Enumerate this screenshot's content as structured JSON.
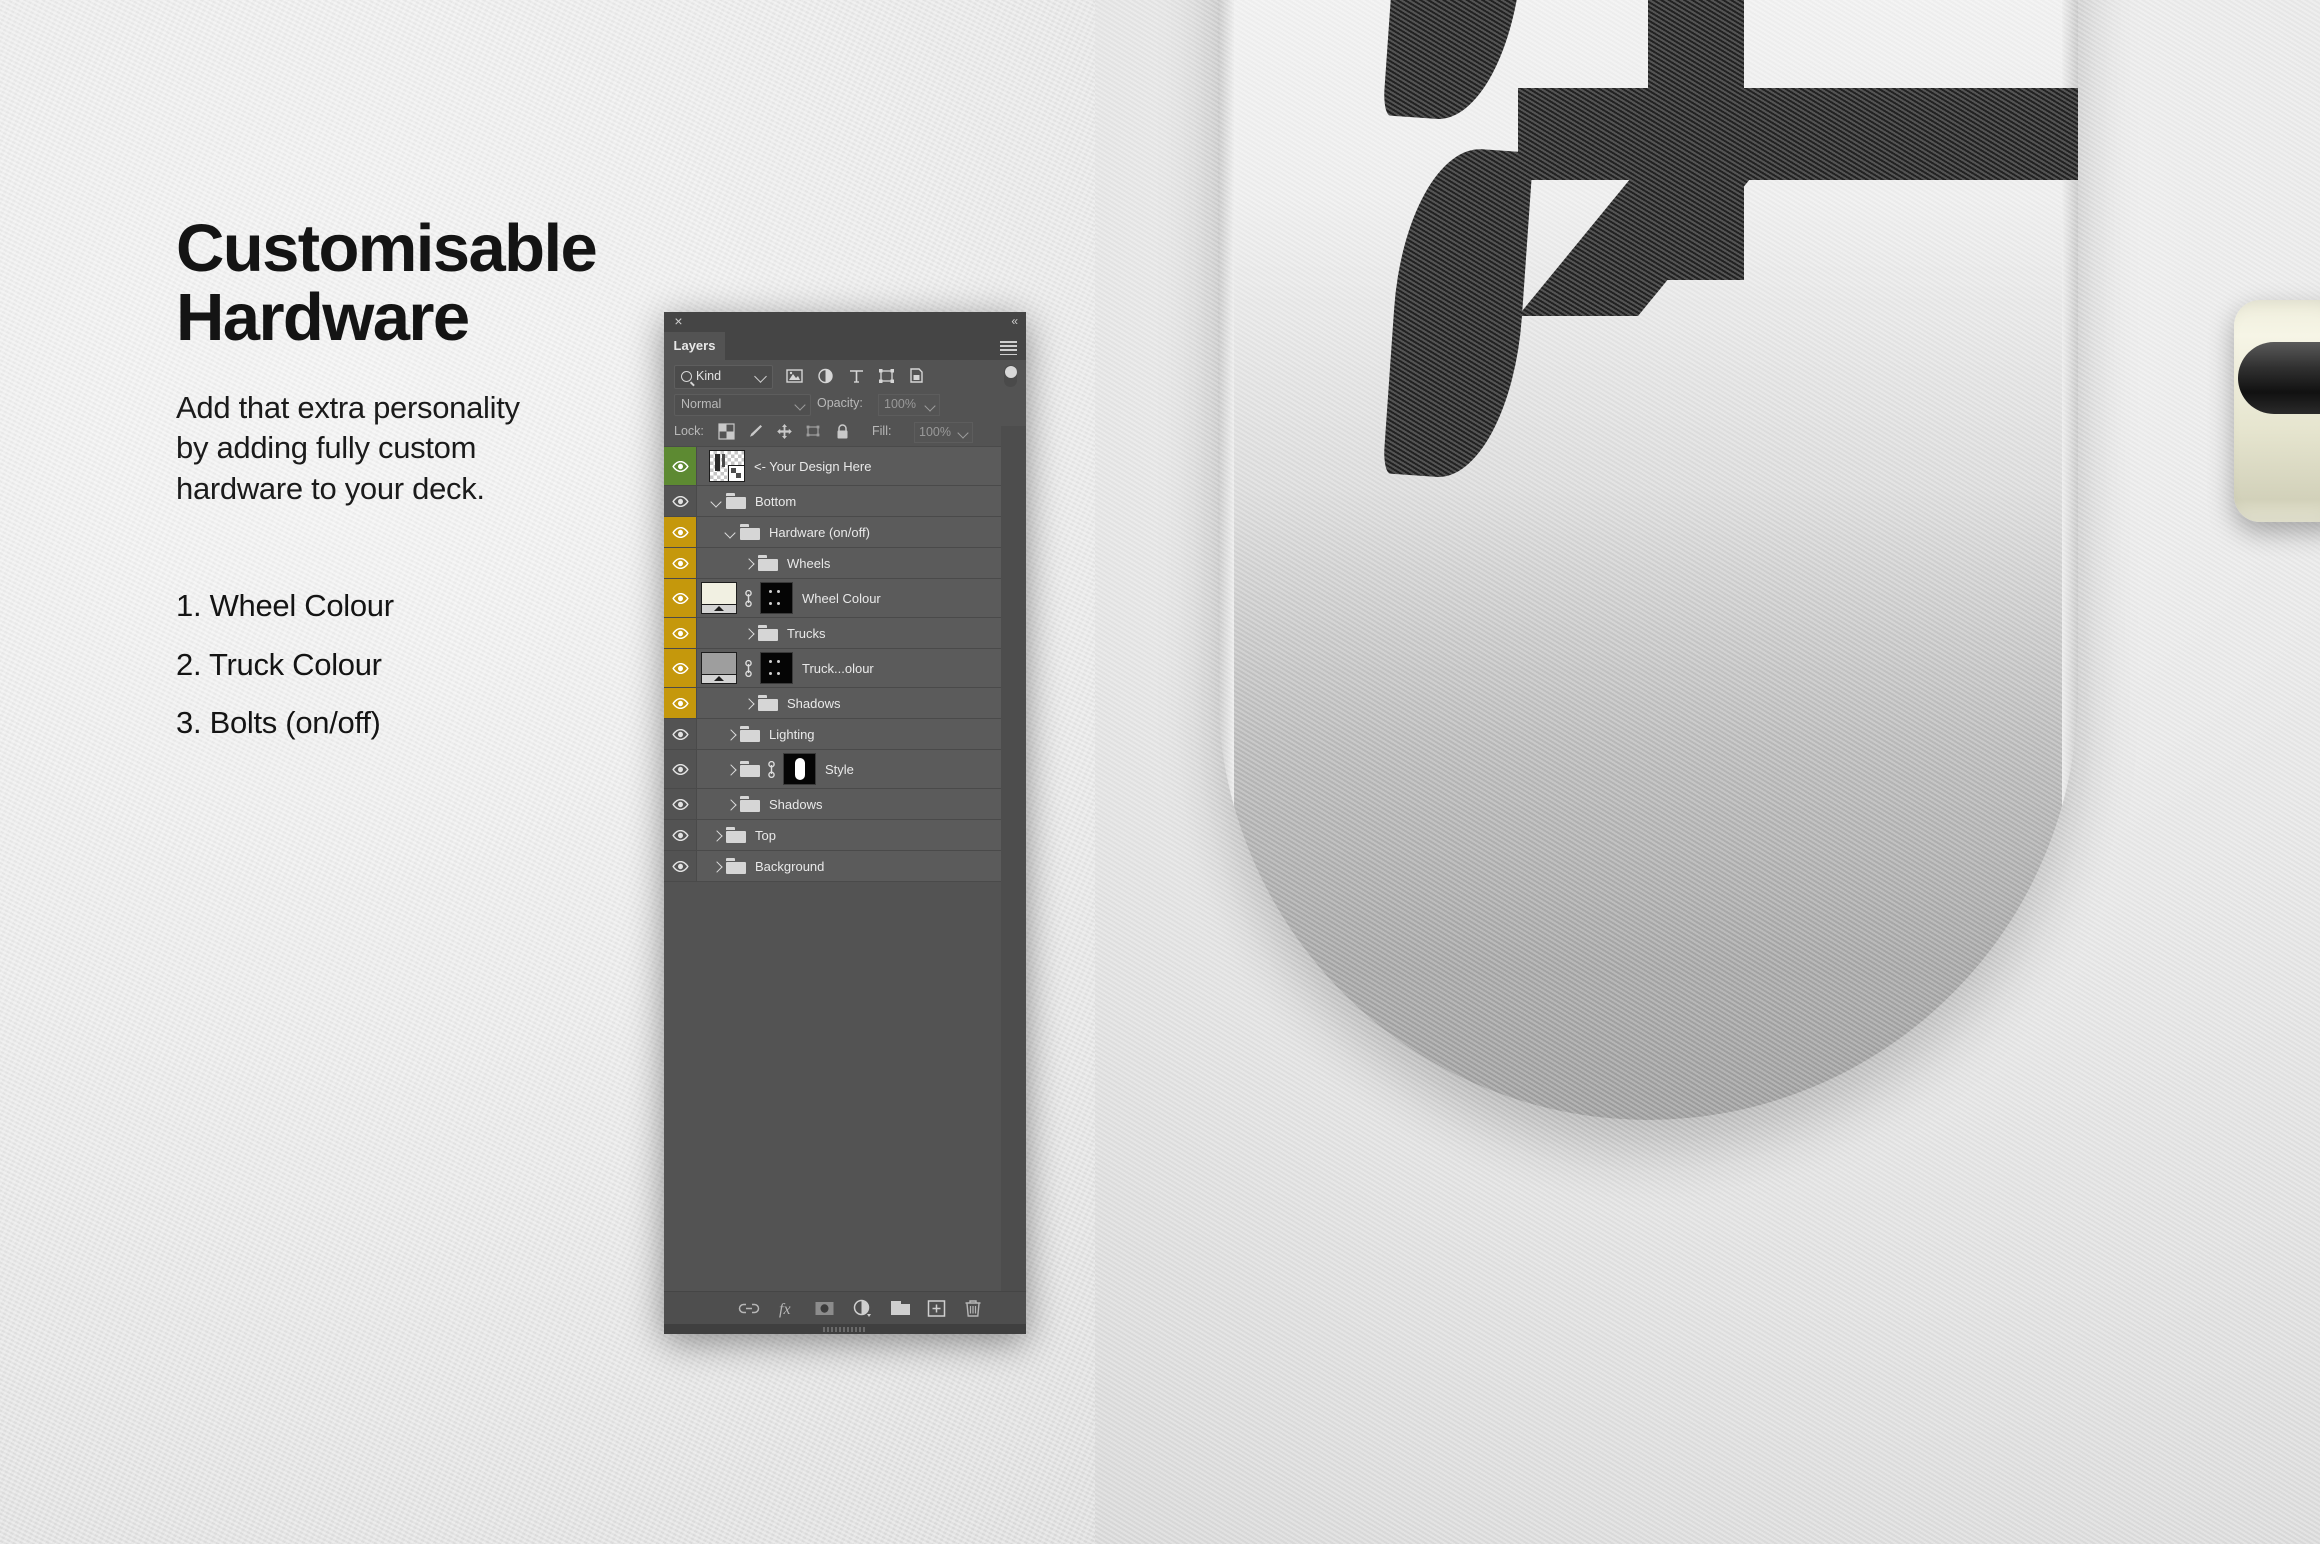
{
  "marketing": {
    "headline_line1": "Customisable",
    "headline_line2": "Hardware",
    "subtext_line1": "Add that extra personality",
    "subtext_line2": "by adding fully custom",
    "subtext_line3": "hardware to your deck.",
    "features": [
      "1. Wheel Colour",
      "2. Truck Colour",
      "3. Bolts (on/off)"
    ]
  },
  "panel": {
    "tab_label": "Layers",
    "close_label": "×",
    "collapse_label": "«",
    "filter": {
      "kind_label": "Kind",
      "icons": [
        "pixel-layer-filter-icon",
        "adjustment-layer-filter-icon",
        "type-layer-filter-icon",
        "shape-layer-filter-icon",
        "smart-object-filter-icon"
      ],
      "toggle_name": "filter-enable-toggle"
    },
    "blend": {
      "mode": "Normal",
      "opacity_label": "Opacity:",
      "opacity_value": "100%"
    },
    "lock": {
      "label": "Lock:",
      "icons": [
        "lock-transparency-icon",
        "lock-image-pixels-icon",
        "lock-position-icon",
        "lock-artboard-nesting-icon",
        "lock-all-icon"
      ],
      "fill_label": "Fill:",
      "fill_value": "100%"
    },
    "layers": [
      {
        "name": "<- Your Design Here",
        "indent": 0,
        "type": "image",
        "highlight": "green",
        "arrow": "none",
        "thumb": "design",
        "visible": true
      },
      {
        "name": "Bottom",
        "indent": 0,
        "type": "group",
        "highlight": "none",
        "arrow": "down",
        "thumb": "folder",
        "visible": true
      },
      {
        "name": "Hardware (on/off)",
        "indent": 1,
        "type": "group",
        "highlight": "gold",
        "arrow": "down",
        "thumb": "folder",
        "visible": true
      },
      {
        "name": "Wheels",
        "indent": 2,
        "type": "group",
        "highlight": "gold",
        "arrow": "right",
        "thumb": "folder",
        "visible": true
      },
      {
        "name": "Wheel Colour",
        "indent": 2,
        "type": "fill",
        "highlight": "gold",
        "arrow": "none",
        "thumb": "fill-cream",
        "visible": true
      },
      {
        "name": "Trucks",
        "indent": 2,
        "type": "group",
        "highlight": "gold",
        "arrow": "right",
        "thumb": "folder",
        "visible": true
      },
      {
        "name": "Truck...olour",
        "indent": 2,
        "type": "fill",
        "highlight": "gold",
        "arrow": "none",
        "thumb": "fill-grey",
        "visible": true
      },
      {
        "name": "Shadows",
        "indent": 2,
        "type": "group",
        "highlight": "gold",
        "arrow": "right",
        "thumb": "folder",
        "visible": true
      },
      {
        "name": "Lighting",
        "indent": 1,
        "type": "group",
        "highlight": "none",
        "arrow": "right",
        "thumb": "folder",
        "visible": true
      },
      {
        "name": "Style",
        "indent": 1,
        "type": "group-masked",
        "highlight": "none",
        "arrow": "right",
        "thumb": "folder-mask",
        "visible": true
      },
      {
        "name": "Shadows",
        "indent": 1,
        "type": "group",
        "highlight": "none",
        "arrow": "right",
        "thumb": "folder",
        "visible": true
      },
      {
        "name": "Top",
        "indent": 0,
        "type": "group",
        "highlight": "none",
        "arrow": "right",
        "thumb": "folder",
        "visible": true
      },
      {
        "name": "Background",
        "indent": 0,
        "type": "group",
        "highlight": "none",
        "arrow": "right",
        "thumb": "folder",
        "visible": true
      }
    ],
    "footer_icons": [
      "link-layers-icon",
      "layer-style-fx-icon",
      "add-layer-mask-icon",
      "new-adjustment-layer-icon",
      "new-group-icon",
      "new-layer-icon",
      "delete-layer-icon"
    ]
  },
  "colors": {
    "panel_bg": "#535353",
    "row_bg": "#5b5b5b",
    "highlight_green": "#5d8a32",
    "highlight_gold": "#c5980c",
    "text": "#e9e9e9",
    "wheel_cream": "#f1f0e2",
    "truck_grey": "#9e9e9e",
    "wall": "#ececec",
    "graphic_black": "#1b1b1b"
  }
}
